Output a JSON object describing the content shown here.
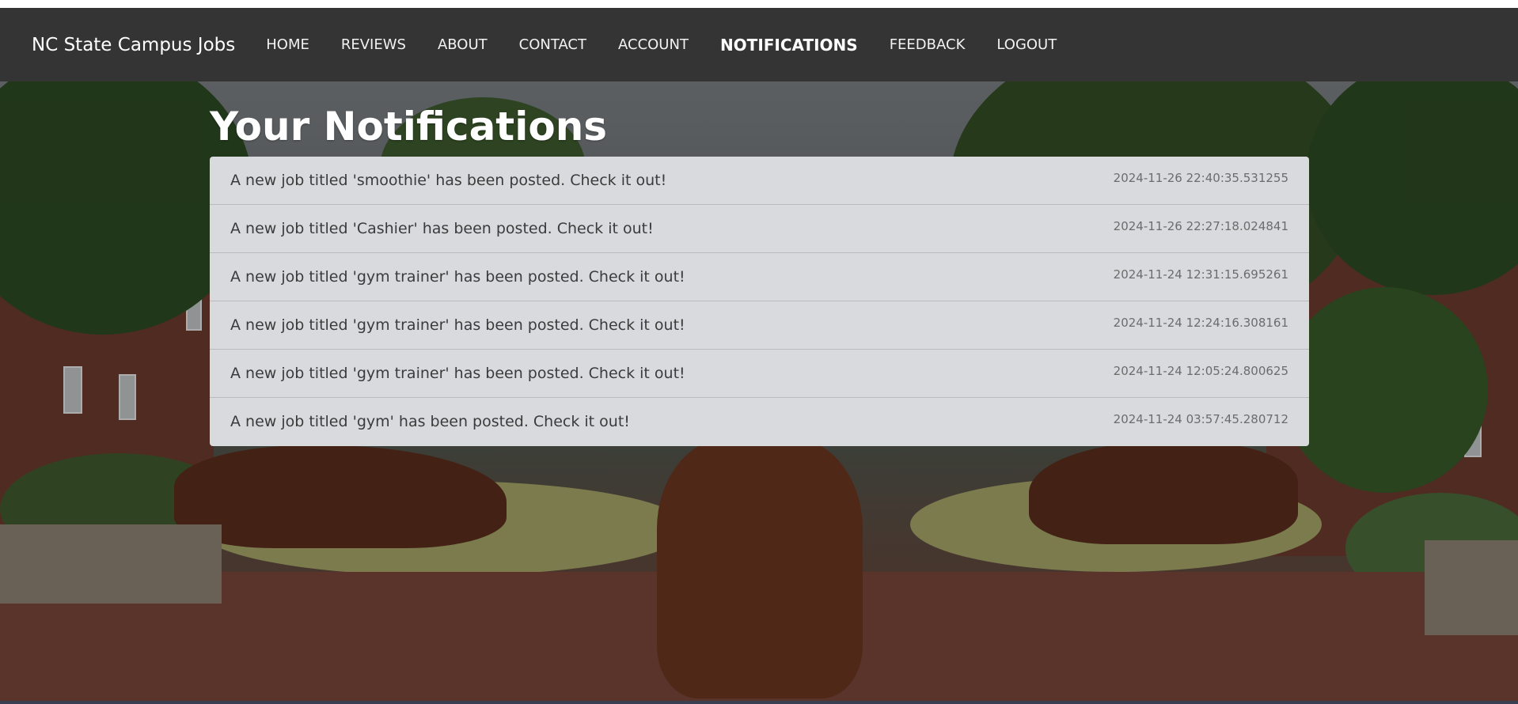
{
  "navbar": {
    "brand": "NC State Campus Jobs",
    "links": [
      {
        "label": "HOME"
      },
      {
        "label": "REVIEWS"
      },
      {
        "label": "ABOUT"
      },
      {
        "label": "CONTACT"
      },
      {
        "label": "ACCOUNT"
      },
      {
        "label": "NOTIFICATIONS",
        "active": true
      },
      {
        "label": "FEEDBACK"
      },
      {
        "label": "LOGOUT"
      }
    ]
  },
  "page": {
    "title": "Your Notifications"
  },
  "notifications": [
    {
      "message": "A new job titled 'smoothie' has been posted. Check it out!",
      "timestamp": "2024-11-26 22:40:35.531255"
    },
    {
      "message": "A new job titled 'Cashier' has been posted. Check it out!",
      "timestamp": "2024-11-26 22:27:18.024841"
    },
    {
      "message": "A new job titled 'gym trainer' has been posted. Check it out!",
      "timestamp": "2024-11-24 12:31:15.695261"
    },
    {
      "message": "A new job titled 'gym trainer' has been posted. Check it out!",
      "timestamp": "2024-11-24 12:24:16.308161"
    },
    {
      "message": "A new job titled 'gym trainer' has been posted. Check it out!",
      "timestamp": "2024-11-24 12:05:24.800625"
    },
    {
      "message": "A new job titled 'gym' has been posted. Check it out!",
      "timestamp": "2024-11-24 03:57:45.280712"
    }
  ],
  "colors": {
    "navbar_bg": "#343434",
    "list_bg": "#d9dadd"
  }
}
